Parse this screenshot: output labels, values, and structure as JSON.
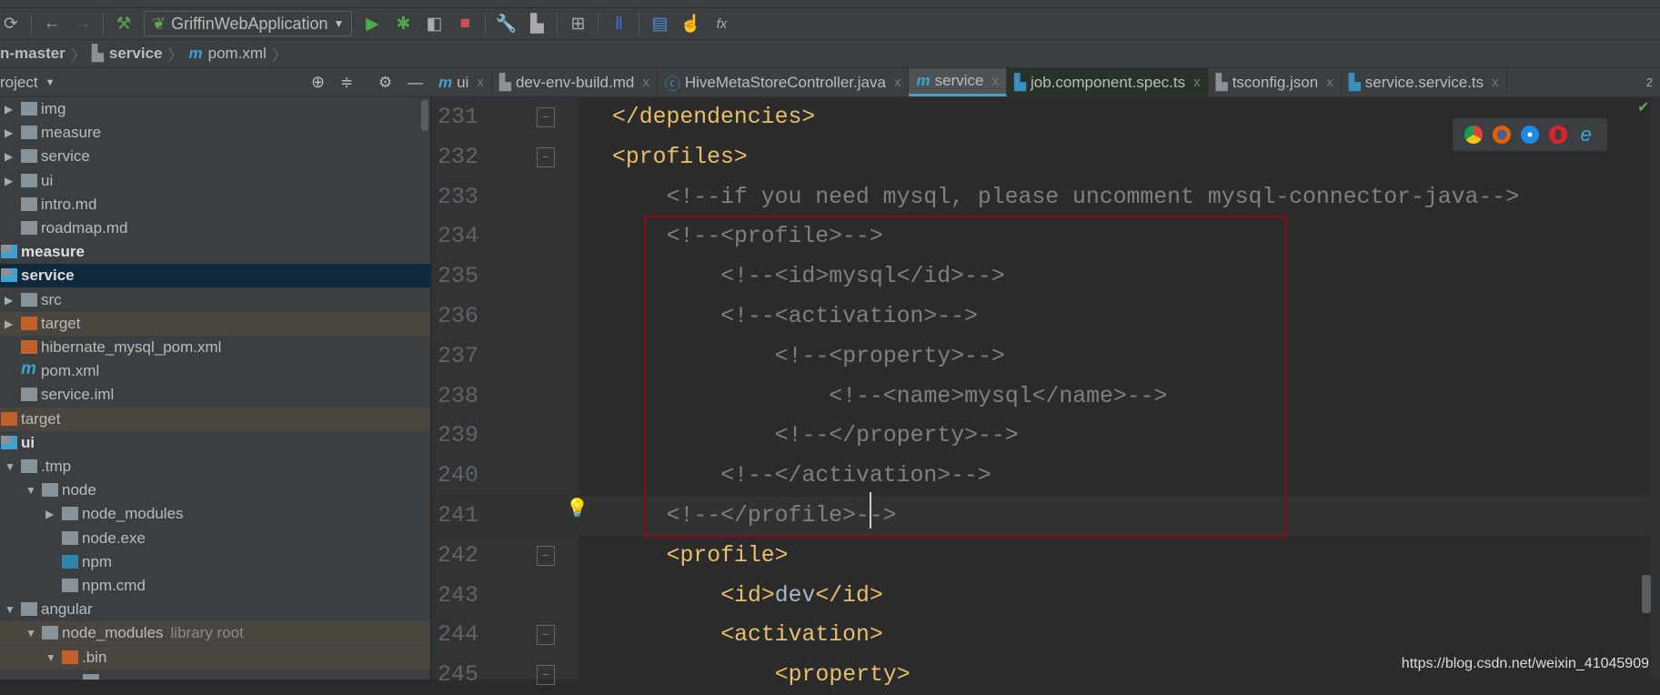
{
  "toolbar": {
    "run_config": "GriffinWebApplication",
    "icons": [
      "sync-icon",
      "back-arrow-icon",
      "forward-arrow-icon",
      "build-hammer-icon",
      "run-icon",
      "debug-icon",
      "coverage-icon",
      "stop-icon",
      "wrench-icon",
      "project-structure-icon",
      "sdk-icon",
      "jrebel-icon",
      "task-icon",
      "touch-icon",
      "fx-icon"
    ]
  },
  "breadcrumb": [
    "n-master",
    "service",
    "pom.xml"
  ],
  "project_panel": {
    "title": "roject"
  },
  "tabs": [
    {
      "label": "ui",
      "icon": "maven-icon"
    },
    {
      "label": "dev-env-build.md",
      "icon": "markdown-icon"
    },
    {
      "label": "HiveMetaStoreController.java",
      "icon": "class-icon"
    },
    {
      "label": "service",
      "icon": "maven-icon",
      "active": true
    },
    {
      "label": "job.component.spec.ts",
      "icon": "typescript-icon"
    },
    {
      "label": "tsconfig.json",
      "icon": "json-icon"
    },
    {
      "label": "service.service.ts",
      "icon": "typescript-icon"
    }
  ],
  "tab_overflow": "2",
  "tree": [
    {
      "label": "img",
      "level": 1,
      "arrow": "right",
      "icon": "folder"
    },
    {
      "label": "measure",
      "level": 1,
      "arrow": "right",
      "icon": "folder"
    },
    {
      "label": "service",
      "level": 1,
      "arrow": "right",
      "icon": "folder"
    },
    {
      "label": "ui",
      "level": 1,
      "arrow": "right",
      "icon": "folder"
    },
    {
      "label": "intro.md",
      "level": 1,
      "icon": "md"
    },
    {
      "label": "roadmap.md",
      "level": 1,
      "icon": "md"
    },
    {
      "label": "measure",
      "level": 0,
      "icon": "module",
      "bold": true
    },
    {
      "label": "service",
      "level": 0,
      "icon": "module",
      "bold": true,
      "selected": true
    },
    {
      "label": "src",
      "level": 1,
      "arrow": "right",
      "icon": "folder"
    },
    {
      "label": "target",
      "level": 1,
      "arrow": "right",
      "icon": "orange-folder",
      "excluded": true
    },
    {
      "label": "hibernate_mysql_pom.xml",
      "level": 1,
      "icon": "xml"
    },
    {
      "label": "pom.xml",
      "level": 1,
      "icon": "maven"
    },
    {
      "label": "service.iml",
      "level": 1,
      "icon": "file"
    },
    {
      "label": "target",
      "level": 0,
      "icon": "orange-folder",
      "excluded": true
    },
    {
      "label": "ui",
      "level": 0,
      "icon": "module",
      "bold": true
    },
    {
      "label": ".tmp",
      "level": 1,
      "arrow": "down",
      "icon": "folder"
    },
    {
      "label": "node",
      "level": 2,
      "arrow": "down",
      "icon": "folder"
    },
    {
      "label": "node_modules",
      "level": 3,
      "arrow": "right",
      "icon": "folder"
    },
    {
      "label": "node.exe",
      "level": 3,
      "icon": "unknown"
    },
    {
      "label": "npm",
      "level": 3,
      "icon": "shell"
    },
    {
      "label": "npm.cmd",
      "level": 3,
      "icon": "text"
    },
    {
      "label": "angular",
      "level": 1,
      "arrow": "down",
      "icon": "folder"
    },
    {
      "label": "node_modules",
      "extra": "library root",
      "level": 2,
      "arrow": "down",
      "icon": "folder",
      "excluded": true
    },
    {
      "label": ".bin",
      "level": 3,
      "arrow": "down",
      "icon": "orange-folder",
      "excluded": true
    },
    {
      "label": "",
      "level": 4,
      "icon": "file"
    }
  ],
  "code": [
    {
      "n": "231",
      "i": 1,
      "seg": [
        [
          "tag",
          "</dependencies>"
        ]
      ],
      "fold": "end"
    },
    {
      "n": "232",
      "i": 1,
      "seg": [
        [
          "tag",
          "<profiles>"
        ]
      ],
      "fold": "start"
    },
    {
      "n": "233",
      "i": 2,
      "seg": [
        [
          "comment",
          "<!--if you need mysql, please uncomment mysql-connector-java-->"
        ]
      ]
    },
    {
      "n": "234",
      "i": 2,
      "seg": [
        [
          "comment",
          "<!--<profile>-->"
        ]
      ]
    },
    {
      "n": "235",
      "i": 3,
      "seg": [
        [
          "comment",
          "<!--<id>mysql</id>-->"
        ]
      ]
    },
    {
      "n": "236",
      "i": 3,
      "seg": [
        [
          "comment",
          "<!--<activation>-->"
        ]
      ]
    },
    {
      "n": "237",
      "i": 4,
      "seg": [
        [
          "comment",
          "<!--<property>-->"
        ]
      ]
    },
    {
      "n": "238",
      "i": 5,
      "seg": [
        [
          "comment",
          "<!--<name>mysql</name>-->"
        ]
      ]
    },
    {
      "n": "239",
      "i": 4,
      "seg": [
        [
          "comment",
          "<!--</property>-->"
        ]
      ]
    },
    {
      "n": "240",
      "i": 3,
      "seg": [
        [
          "comment",
          "<!--</activation>-->"
        ]
      ]
    },
    {
      "n": "241",
      "i": 2,
      "seg": [
        [
          "comment",
          "<!--</profile>-->"
        ]
      ]
    },
    {
      "n": "242",
      "i": 2,
      "seg": [
        [
          "tag",
          "<profile>"
        ]
      ],
      "fold": "start"
    },
    {
      "n": "243",
      "i": 3,
      "seg": [
        [
          "tag",
          "<id>"
        ],
        [
          "text",
          "dev"
        ],
        [
          "tag",
          "</id>"
        ]
      ]
    },
    {
      "n": "244",
      "i": 3,
      "seg": [
        [
          "tag",
          "<activation>"
        ]
      ],
      "fold": "start"
    },
    {
      "n": "245",
      "i": 4,
      "seg": [
        [
          "tag",
          "<property>"
        ]
      ],
      "fold": "start"
    }
  ],
  "browser_icons": [
    "chrome-icon",
    "firefox-icon",
    "safari-icon",
    "opera-icon",
    "ie-icon"
  ],
  "watermark": "https://blog.csdn.net/weixin_41045909",
  "colors": {
    "tag": "#e8bf6a",
    "comment": "#808080",
    "selection": "#0d293e",
    "highlight_box": "#8b0a1a",
    "accent": "#4a9fbf"
  }
}
